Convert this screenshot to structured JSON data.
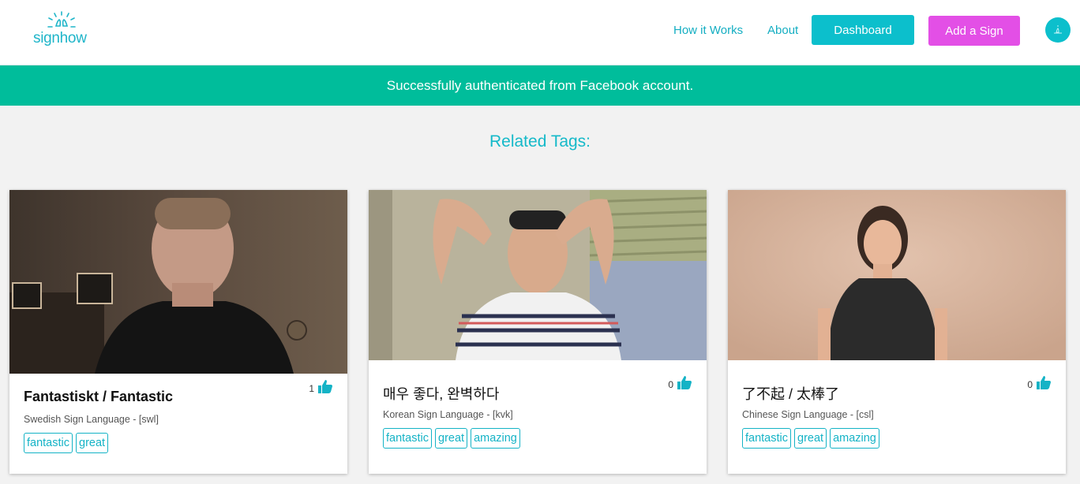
{
  "brand": {
    "name": "signhow",
    "color": "#1fb5c9"
  },
  "nav": {
    "how_it_works": "How it Works",
    "about": "About",
    "dashboard": "Dashboard",
    "add_sign": "Add a Sign"
  },
  "banner": {
    "message": "Successfully authenticated from Facebook account.",
    "color": "#00bd9b"
  },
  "related_tags_heading": "Related Tags:",
  "cards": [
    {
      "title": "Fantastiskt / Fantastic",
      "language": "Swedish Sign Language - [swl]",
      "likes": "1",
      "tags": [
        "fantastic",
        "great"
      ]
    },
    {
      "title": "매우 좋다, 완벽하다",
      "language": "Korean Sign Language - [kvk]",
      "likes": "0",
      "tags": [
        "fantastic",
        "great",
        "amazing"
      ]
    },
    {
      "title": "了不起 / 太棒了",
      "language": "Chinese Sign Language - [csl]",
      "likes": "0",
      "tags": [
        "fantastic",
        "great",
        "amazing"
      ]
    }
  ],
  "colors": {
    "accent": "#0cbfcc",
    "add_button": "#e34fe6",
    "tag": "#14b3c6"
  },
  "icons": [
    "signhow-logo",
    "thumbs-up-icon",
    "user-avatar"
  ]
}
